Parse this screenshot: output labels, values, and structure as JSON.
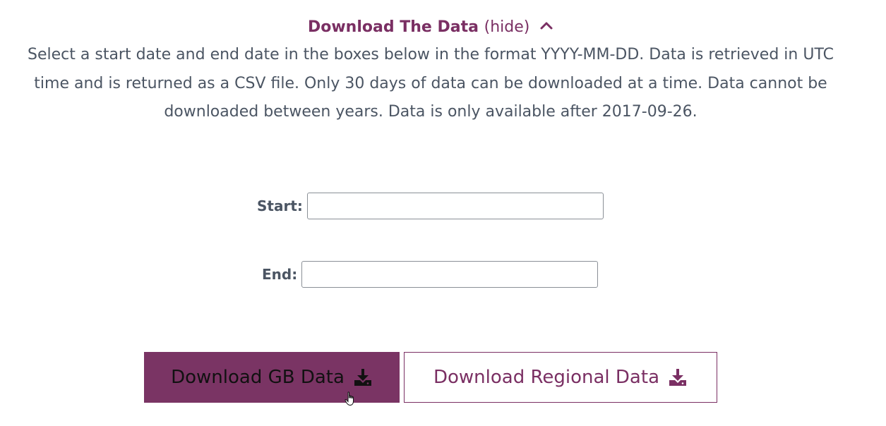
{
  "toggle": {
    "title": "Download The Data",
    "state_label": "(hide)",
    "icon": "chevron-up-icon"
  },
  "description": "Select a start date and end date in the boxes below in the format YYYY-MM-DD. Data is retrieved in UTC time and is returned as a CSV file. Only 30 days of data can be downloaded at a time. Data cannot be downloaded between years. Data is only available after 2017-09-26.",
  "form": {
    "start_label": "Start:",
    "start_value": "",
    "end_label": "End:",
    "end_value": ""
  },
  "buttons": {
    "gb_label": "Download GB Data",
    "regional_label": "Download Regional Data",
    "icon": "download-icon"
  },
  "colors": {
    "accent": "#7a2f63",
    "button_fill": "#7a3464",
    "text": "#4b5563"
  }
}
